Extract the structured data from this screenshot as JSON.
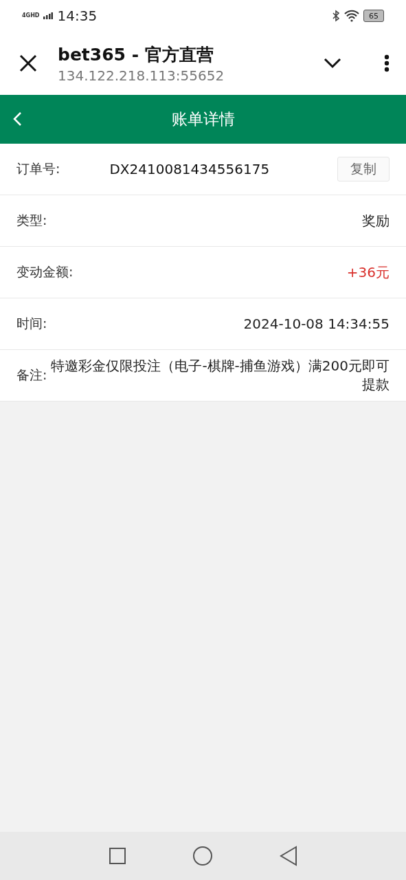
{
  "status_bar": {
    "network": "4GHD",
    "time": "14:35",
    "battery": "65"
  },
  "browser_bar": {
    "title": "bet365 - 官方直营",
    "url": "134.122.218.113:55652"
  },
  "nav_bar": {
    "title": "账单详情"
  },
  "details": [
    {
      "kind": "copy",
      "label": "订单号:",
      "value": "DX2410081434556175",
      "button": "复制"
    },
    {
      "kind": "plain",
      "label": "类型:",
      "value": "奖励"
    },
    {
      "kind": "amount",
      "label": "变动金额:",
      "value": "+36元"
    },
    {
      "kind": "plain",
      "label": "时间:",
      "value": "2024-10-08 14:34:55"
    },
    {
      "kind": "plain",
      "label": "备注:",
      "value": "特邀彩金仅限投注（电子-棋牌-捕鱼游戏）满200元即可提款"
    }
  ]
}
